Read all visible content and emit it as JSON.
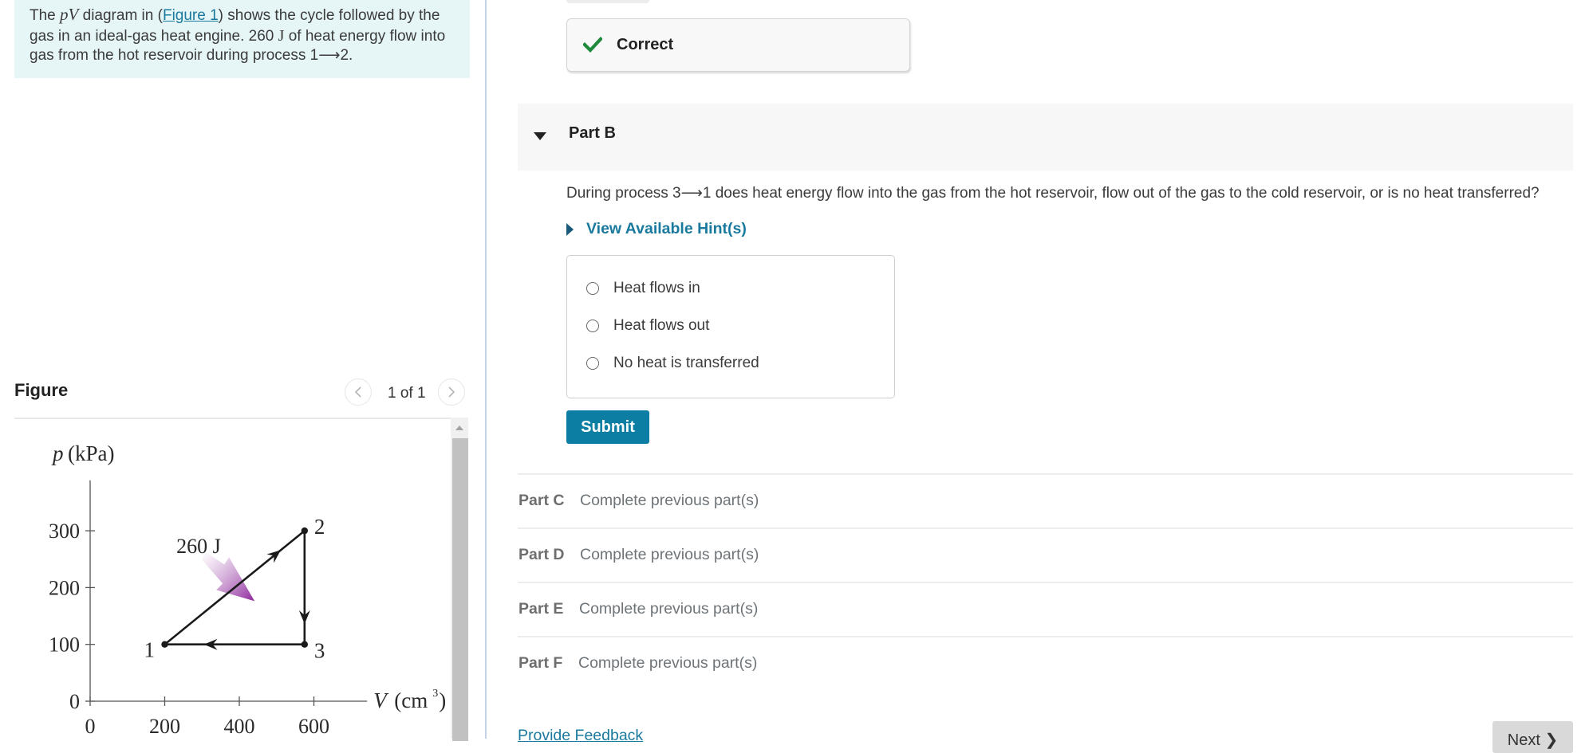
{
  "problem": {
    "intro_pre": "The ",
    "intro_math_pV": "pV",
    "intro_mid1": " diagram in (",
    "intro_link": "Figure 1",
    "intro_mid2": ") shows the cycle followed by the gas in an ideal-gas heat engine. 260 ",
    "intro_unit": "J",
    "intro_post": " of heat energy flow into gas from the hot reservoir during process 1⟶2."
  },
  "figure": {
    "title": "Figure",
    "counter": "1 of 1",
    "prev_icon": "chevron-left-icon",
    "next_icon": "chevron-right-icon"
  },
  "chart_data": {
    "type": "line",
    "title": "",
    "xlabel": "V (cm³)",
    "xlabel_main": "V",
    "xlabel_unit_open": "(cm",
    "xlabel_sup": "3",
    "xlabel_unit_close": ")",
    "ylabel": "p (kPa)",
    "ylabel_main": "p",
    "ylabel_unit": "(kPa)",
    "xlim": [
      0,
      700
    ],
    "ylim": [
      0,
      400
    ],
    "xticks": [
      0,
      200,
      400,
      600
    ],
    "yticks": [
      0,
      100,
      200,
      300
    ],
    "grid": false,
    "points": [
      {
        "label": "1",
        "V": 200,
        "p": 100
      },
      {
        "label": "2",
        "V": 575,
        "p": 300
      },
      {
        "label": "3",
        "V": 575,
        "p": 100
      }
    ],
    "processes": [
      {
        "from": "1",
        "to": "2"
      },
      {
        "from": "2",
        "to": "3"
      },
      {
        "from": "3",
        "to": "1"
      }
    ],
    "annotations": [
      {
        "text": "260 J",
        "description": "heat flowing into gas during process 1→2 (purple arrow)",
        "color": "#8e2a9c"
      }
    ]
  },
  "status": {
    "correct_label": "Correct",
    "correct_color": "#1f8a3c"
  },
  "part_b": {
    "title": "Part B",
    "question": "During process 3⟶1 does heat energy flow into the gas from the hot reservoir, flow out of the gas to the cold reservoir, or is no heat transferred?",
    "hints_label": "View Available Hint(s)",
    "choices": [
      {
        "label": "Heat flows in",
        "selected": false
      },
      {
        "label": "Heat flows out",
        "selected": false
      },
      {
        "label": "No heat is transferred",
        "selected": false
      }
    ],
    "submit_label": "Submit"
  },
  "locked_parts": [
    {
      "name": "Part C",
      "status": "Complete previous part(s)"
    },
    {
      "name": "Part D",
      "status": "Complete previous part(s)"
    },
    {
      "name": "Part E",
      "status": "Complete previous part(s)"
    },
    {
      "name": "Part F",
      "status": "Complete previous part(s)"
    }
  ],
  "footer": {
    "feedback_label": "Provide Feedback",
    "next_label": "Next ❯"
  },
  "colors": {
    "accent": "#0d7ea3",
    "link": "#1a7a9e",
    "intro_bg": "#e6f6f7",
    "correct": "#1f8a3c"
  }
}
